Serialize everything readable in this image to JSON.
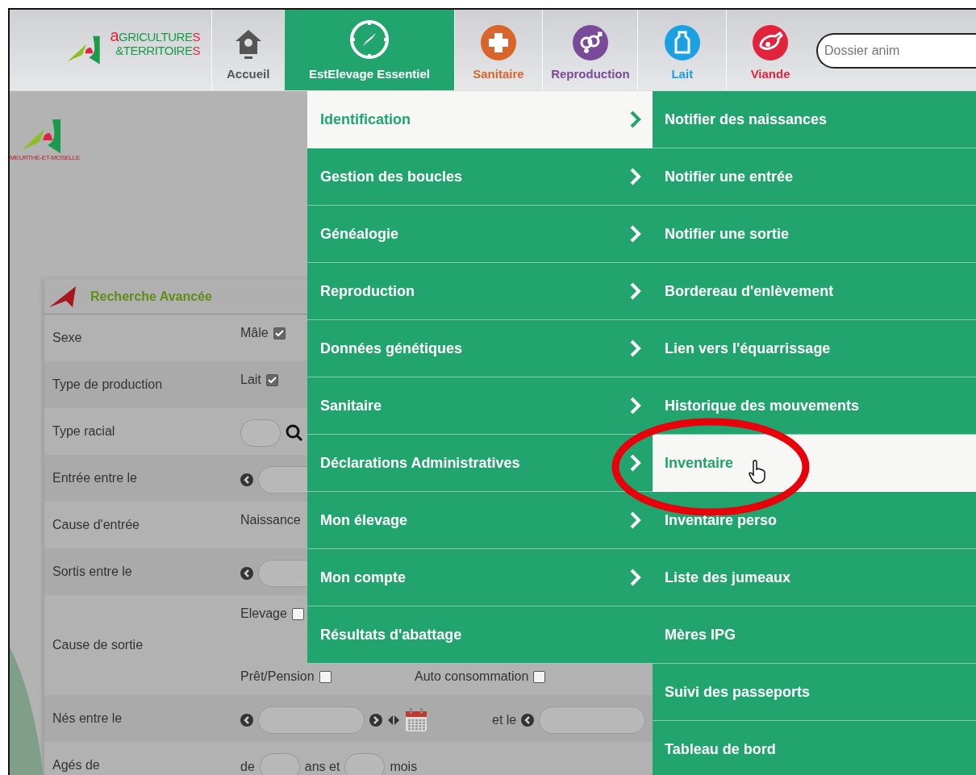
{
  "brand": {
    "line1": "aGRICULTURES",
    "line2": "&TERRITOIRES"
  },
  "tabs": [
    {
      "label": "Accueil",
      "color": "#555555",
      "selected": false
    },
    {
      "label": "EstElevage Essentiel",
      "color": "#ffffff",
      "selected": true
    },
    {
      "label": "Sanitaire",
      "color": "#d9652a",
      "selected": false
    },
    {
      "label": "Reproduction",
      "color": "#7a4a9a",
      "selected": false
    },
    {
      "label": "Lait",
      "color": "#1ba0e2",
      "selected": false
    },
    {
      "label": "Viande",
      "color": "#e2233e",
      "selected": false
    }
  ],
  "search": {
    "placeholder": "Dossier anim"
  },
  "local_logo": {
    "caption": "MEURTHE-ET-MOSELLE"
  },
  "panel": {
    "title": "Recherche Avancée",
    "rows": [
      {
        "label": "Sexe",
        "lines": [
          [
            [
              {
                "kind": "text",
                "text": "Mâle"
              },
              {
                "kind": "checkbox",
                "checked": true
              }
            ]
          ]
        ]
      },
      {
        "label": "Type de production",
        "lines": [
          [
            [
              {
                "kind": "text",
                "text": "Lait"
              },
              {
                "kind": "checkbox",
                "checked": true
              }
            ]
          ]
        ]
      },
      {
        "label": "Type racial",
        "lines": [
          [
            [
              {
                "kind": "short_input"
              },
              {
                "kind": "search"
              }
            ]
          ]
        ]
      },
      {
        "label": "Entrée entre le",
        "lines": [
          [
            [
              {
                "kind": "prev"
              },
              {
                "kind": "input"
              }
            ]
          ]
        ]
      },
      {
        "label": "Cause d'entrée",
        "lines": [
          [
            [
              {
                "kind": "text",
                "text": "Naissance"
              }
            ]
          ]
        ]
      },
      {
        "label": "Sortis entre le",
        "lines": [
          [
            [
              {
                "kind": "prev"
              },
              {
                "kind": "input"
              }
            ]
          ]
        ]
      },
      {
        "label": "Cause de sortie",
        "kind": "narrow",
        "lines": [
          [
            [
              {
                "kind": "text",
                "text": "Elevage"
              },
              {
                "kind": "checkbox",
                "checked": false
              }
            ]
          ],
          [
            [
              {
                "kind": "text",
                "text": "Prêt/Pension"
              },
              {
                "kind": "checkbox",
                "checked": false
              }
            ],
            [
              {
                "kind": "text",
                "text": "Auto consommation"
              },
              {
                "kind": "checkbox",
                "checked": false
              }
            ]
          ]
        ]
      },
      {
        "label": "Nés entre le",
        "lines": [
          [
            [
              {
                "kind": "prev"
              },
              {
                "kind": "input"
              },
              {
                "kind": "next"
              },
              {
                "kind": "arrows"
              },
              {
                "kind": "calendar"
              }
            ],
            [
              {
                "kind": "text",
                "text": "et le"
              },
              {
                "kind": "prev"
              },
              {
                "kind": "input"
              }
            ]
          ]
        ]
      },
      {
        "label": "Agés de",
        "lines": [
          [
            [
              {
                "kind": "text",
                "text": "de"
              },
              {
                "kind": "short_input"
              },
              {
                "kind": "text",
                "text": "ans et"
              },
              {
                "kind": "short_input"
              },
              {
                "kind": "text",
                "text": "mois"
              }
            ]
          ]
        ]
      }
    ]
  },
  "menu": {
    "sections": [
      {
        "label": "Identification",
        "selected": true,
        "has_submenu": true
      },
      {
        "label": "Gestion des boucles",
        "selected": false,
        "has_submenu": true
      },
      {
        "label": "Généalogie",
        "selected": false,
        "has_submenu": true
      },
      {
        "label": "Reproduction",
        "selected": false,
        "has_submenu": true
      },
      {
        "label": "Données génétiques",
        "selected": false,
        "has_submenu": true
      },
      {
        "label": "Sanitaire",
        "selected": false,
        "has_submenu": true
      },
      {
        "label": "Déclarations Administratives",
        "selected": false,
        "has_submenu": true
      },
      {
        "label": "Mon élevage",
        "selected": false,
        "has_submenu": true
      },
      {
        "label": "Mon compte",
        "selected": false,
        "has_submenu": true
      },
      {
        "label": "Résultats d'abattage",
        "selected": false,
        "has_submenu": false
      }
    ],
    "submenu": [
      {
        "label": "Notifier des naissances",
        "selected": false
      },
      {
        "label": "Notifier une entrée",
        "selected": false
      },
      {
        "label": "Notifier une sortie",
        "selected": false
      },
      {
        "label": "Bordereau d'enlèvement",
        "selected": false
      },
      {
        "label": "Lien vers l'équarrissage",
        "selected": false
      },
      {
        "label": "Historique des mouvements",
        "selected": false
      },
      {
        "label": "Inventaire",
        "selected": true
      },
      {
        "label": "Inventaire perso",
        "selected": false
      },
      {
        "label": "Liste des jumeaux",
        "selected": false
      },
      {
        "label": "Mères IPG",
        "selected": false
      },
      {
        "label": "Suivi des passeports",
        "selected": false
      },
      {
        "label": "Tableau de bord",
        "selected": false
      }
    ]
  }
}
